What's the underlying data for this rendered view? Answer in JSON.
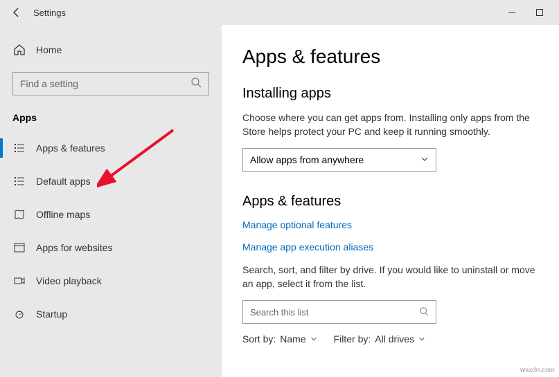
{
  "window": {
    "title": "Settings"
  },
  "sidebar": {
    "home": "Home",
    "search_placeholder": "Find a setting",
    "section": "Apps",
    "items": [
      {
        "label": "Apps & features"
      },
      {
        "label": "Default apps"
      },
      {
        "label": "Offline maps"
      },
      {
        "label": "Apps for websites"
      },
      {
        "label": "Video playback"
      },
      {
        "label": "Startup"
      }
    ]
  },
  "main": {
    "heading": "Apps & features",
    "installing": {
      "title": "Installing apps",
      "desc": "Choose where you can get apps from. Installing only apps from the Store helps protect your PC and keep it running smoothly.",
      "dropdown_value": "Allow apps from anywhere"
    },
    "apps_features": {
      "title": "Apps & features",
      "link1": "Manage optional features",
      "link2": "Manage app execution aliases",
      "desc": "Search, sort, and filter by drive. If you would like to uninstall or move an app, select it from the list.",
      "search_placeholder": "Search this list",
      "sort_label": "Sort by:",
      "sort_value": "Name",
      "filter_label": "Filter by:",
      "filter_value": "All drives"
    }
  },
  "watermark": "wsxdn.com"
}
